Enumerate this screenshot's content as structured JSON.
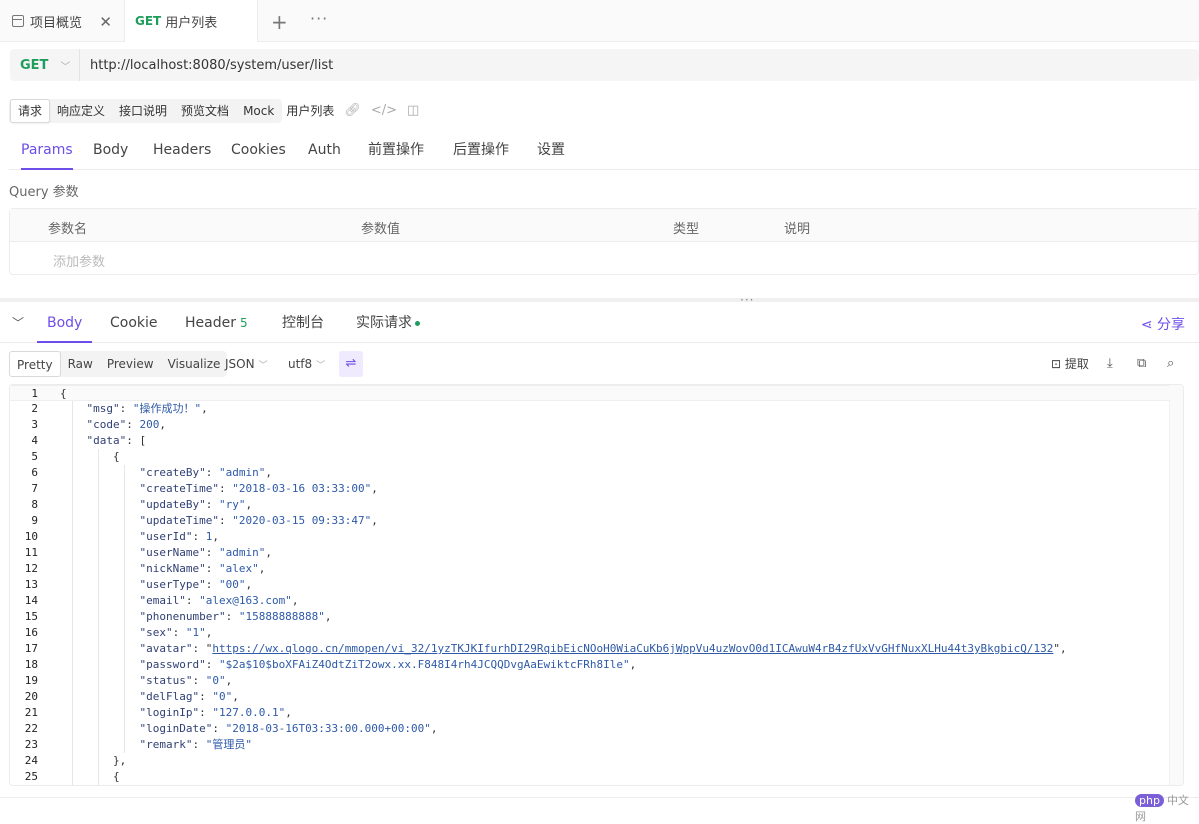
{
  "tabs": {
    "overview_label": "项目概览",
    "active_method": "GET",
    "active_label": "用户列表",
    "add_label": "+",
    "more_label": "···",
    "close_label": "✕"
  },
  "url_bar": {
    "method": "GET",
    "url": "http://localhost:8080/system/user/list"
  },
  "sub_toolbar": {
    "items": [
      "请求",
      "响应定义",
      "接口说明",
      "预览文档",
      "Mock"
    ],
    "doc_title": "用户列表"
  },
  "request_tabs": [
    "Params",
    "Body",
    "Headers",
    "Cookies",
    "Auth",
    "前置操作",
    "后置操作",
    "设置"
  ],
  "query": {
    "section_label": "Query 参数",
    "columns": [
      "参数名",
      "参数值",
      "类型",
      "说明"
    ],
    "add_placeholder": "添加参数"
  },
  "response_tabs": {
    "body": "Body",
    "cookie": "Cookie",
    "header": "Header",
    "header_count": "5",
    "console": "控制台",
    "actual_request": "实际请求",
    "share": "分享"
  },
  "response_toolbar": {
    "formats": [
      "Pretty",
      "Raw",
      "Preview",
      "Visualize"
    ],
    "type_select": "JSON",
    "encoding_select": "utf8",
    "extract_label": "提取"
  },
  "code_lines": [
    {
      "n": "1",
      "t": "{"
    },
    {
      "n": "2",
      "t": "    \"msg\": \"操作成功！\","
    },
    {
      "n": "3",
      "t": "    \"code\": 200,"
    },
    {
      "n": "4",
      "t": "    \"data\": ["
    },
    {
      "n": "5",
      "t": "        {"
    },
    {
      "n": "6",
      "t": "            \"createBy\": \"admin\","
    },
    {
      "n": "7",
      "t": "            \"createTime\": \"2018-03-16 03:33:00\","
    },
    {
      "n": "8",
      "t": "            \"updateBy\": \"ry\","
    },
    {
      "n": "9",
      "t": "            \"updateTime\": \"2020-03-15 09:33:47\","
    },
    {
      "n": "10",
      "t": "            \"userId\": 1,"
    },
    {
      "n": "11",
      "t": "            \"userName\": \"admin\","
    },
    {
      "n": "12",
      "t": "            \"nickName\": \"alex\","
    },
    {
      "n": "13",
      "t": "            \"userType\": \"00\","
    },
    {
      "n": "14",
      "t": "            \"email\": \"alex@163.com\","
    },
    {
      "n": "15",
      "t": "            \"phonenumber\": \"15888888888\","
    },
    {
      "n": "16",
      "t": "            \"sex\": \"1\","
    },
    {
      "n": "17",
      "t": "            \"avatar\": \"https://wx.qlogo.cn/mmopen/vi_32/1yzTKJKIfurhDI29RqibEicNOoH0WiaCuKb6jWppVu4uzWovO0d1ICAwuW4rB4zfUxVvGHfNuxXLHu44t3yBkgbicQ/132\","
    },
    {
      "n": "18",
      "t": "            \"password\": \"$2a$10$boXFAiZ4OdtZiT2owx.xx.F848I4rh4JCQQDvgAaEwiktcFRh8Ile\","
    },
    {
      "n": "19",
      "t": "            \"status\": \"0\","
    },
    {
      "n": "20",
      "t": "            \"delFlag\": \"0\","
    },
    {
      "n": "21",
      "t": "            \"loginIp\": \"127.0.0.1\","
    },
    {
      "n": "22",
      "t": "            \"loginDate\": \"2018-03-16T03:33:00.000+00:00\","
    },
    {
      "n": "23",
      "t": "            \"remark\": \"管理员\""
    },
    {
      "n": "24",
      "t": "        },"
    },
    {
      "n": "25",
      "t": "        {"
    }
  ],
  "watermark": {
    "badge": "php",
    "text": "中文网"
  }
}
